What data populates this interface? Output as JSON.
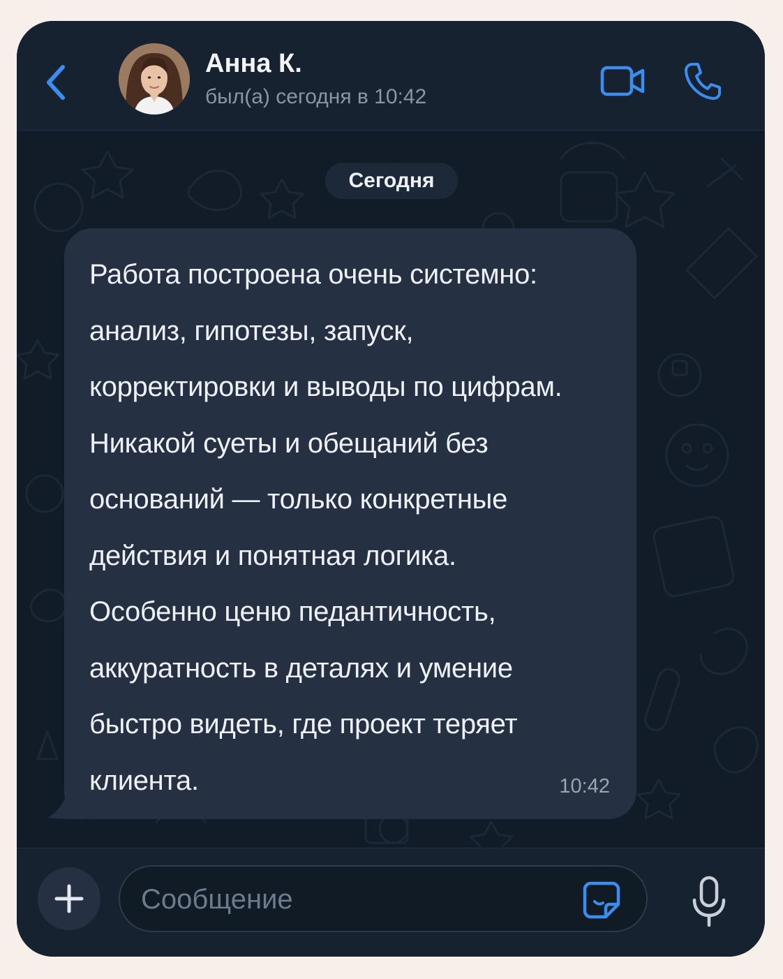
{
  "header": {
    "contact_name": "Анна К.",
    "status": "был(а) сегодня в 10:42"
  },
  "chat": {
    "date_separator": "Сегодня",
    "messages": [
      {
        "text": "Работа построена очень системно:\nанализ, гипотезы, запуск,\nкорректировки и выводы по цифрам.\nНикакой суеты и обещаний без\nоснований — только конкретные\nдействия и понятная логика.\nОсобенно ценю педантичность,\nаккуратность в деталях и умение\nбыстро видеть, где проект теряет\nклиента.",
        "time": "10:42",
        "direction": "incoming"
      }
    ]
  },
  "input": {
    "placeholder": "Сообщение"
  },
  "icons": {
    "back": "chevron-left-icon",
    "video": "video-camera-icon",
    "call": "phone-icon",
    "attach": "plus-icon",
    "sticker": "sticker-icon",
    "voice": "microphone-icon"
  },
  "colors": {
    "accent": "#3b8ef0",
    "background": "#121c28",
    "header": "#172230",
    "bubble_incoming": "#253142",
    "page": "#f7f0ea"
  }
}
